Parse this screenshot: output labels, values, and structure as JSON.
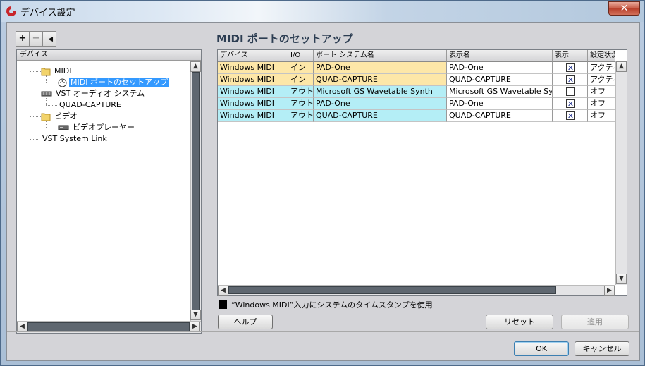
{
  "window": {
    "title": "デバイス設定",
    "close_symbol": "✕"
  },
  "toolbar": {
    "add": "+",
    "remove": "−",
    "reset": "|◀"
  },
  "tree": {
    "header": "デバイス",
    "nodes": [
      {
        "label": "MIDI",
        "icon": "folder-icon"
      },
      {
        "label": "MIDI ポートのセットアップ",
        "icon": "midi-port-icon",
        "selected": true
      },
      {
        "label": "VST オーディオ システム",
        "icon": "audio-device-icon"
      },
      {
        "label": "QUAD-CAPTURE"
      },
      {
        "label": "ビデオ",
        "icon": "folder-icon"
      },
      {
        "label": "ビデオプレーヤー",
        "icon": "video-player-icon"
      },
      {
        "label": "VST System Link"
      }
    ]
  },
  "section": {
    "title": "MIDI ポートのセットアップ"
  },
  "table": {
    "columns": [
      "デバイス",
      "I/O",
      "ポート システム名",
      "表示名",
      "表示",
      "設定状況"
    ],
    "rows": [
      {
        "device": "Windows MIDI",
        "io": "イン",
        "port": "PAD-One",
        "name": "PAD-One",
        "show": true,
        "status": "アクティブ",
        "color": "#fde7a8"
      },
      {
        "device": "Windows MIDI",
        "io": "イン",
        "port": "QUAD-CAPTURE",
        "name": "QUAD-CAPTURE",
        "show": true,
        "status": "アクティブ",
        "color": "#fde7a8"
      },
      {
        "device": "Windows MIDI",
        "io": "アウト",
        "port": "Microsoft GS Wavetable Synth",
        "name": "Microsoft GS Wavetable Synth",
        "show": false,
        "status": "オフ",
        "color": "#b4eef6"
      },
      {
        "device": "Windows MIDI",
        "io": "アウト",
        "port": "PAD-One",
        "name": "PAD-One",
        "show": true,
        "status": "オフ",
        "color": "#b4eef6"
      },
      {
        "device": "Windows MIDI",
        "io": "アウト",
        "port": "QUAD-CAPTURE",
        "name": "QUAD-CAPTURE",
        "show": true,
        "status": "オフ",
        "color": "#b4eef6"
      }
    ]
  },
  "timestamp_option": {
    "label": "“Windows MIDI”入力にシステムのタイムスタンプを使用",
    "checked": true
  },
  "buttons": {
    "help": "ヘルプ",
    "reset": "リセット",
    "apply": "適用",
    "ok": "OK",
    "cancel": "キャンセル"
  },
  "scroll": {
    "up": "▲",
    "down": "▼",
    "left": "◀",
    "right": "▶"
  }
}
